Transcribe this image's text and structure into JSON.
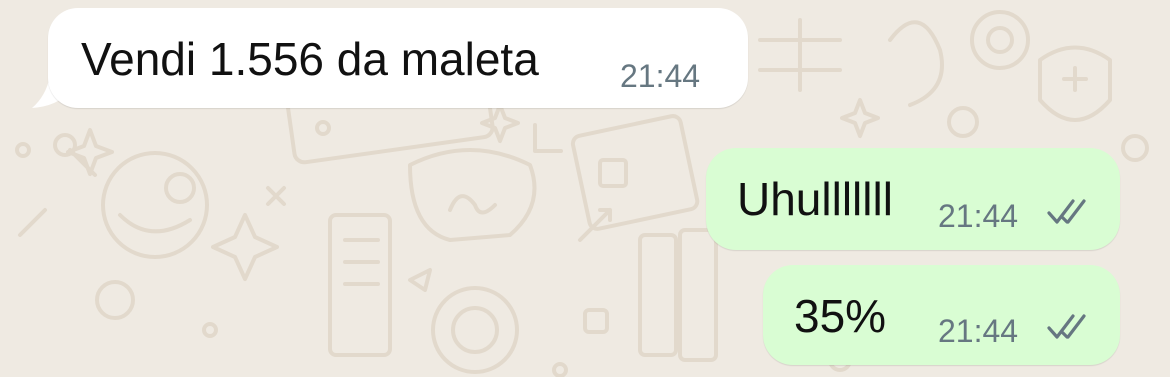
{
  "chat": {
    "messages": [
      {
        "direction": "incoming",
        "text": "Vendi 1.556 da maleta",
        "time": "21:44"
      },
      {
        "direction": "outgoing",
        "text": "Uhulllllll",
        "time": "21:44",
        "status": "read",
        "status_icon": "double-check-icon"
      },
      {
        "direction": "outgoing",
        "text": "35%",
        "time": "21:44",
        "status": "read",
        "status_icon": "double-check-icon"
      }
    ]
  },
  "colors": {
    "background": "#efeae2",
    "incoming_bubble": "#ffffff",
    "outgoing_bubble": "#d9fdd3",
    "text": "#111111",
    "meta_text": "#667781",
    "ticks": "#667781"
  }
}
